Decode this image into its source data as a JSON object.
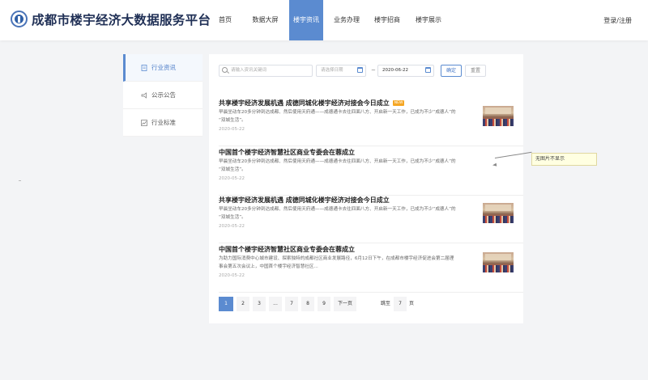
{
  "header": {
    "site_title": "成都市楼宇经济大数据服务平台",
    "nav": [
      {
        "label": "首页",
        "active": false
      },
      {
        "label": "数据大屏",
        "active": false
      },
      {
        "label": "楼宇资讯",
        "active": true
      },
      {
        "label": "业务办理",
        "active": false
      },
      {
        "label": "楼宇招商",
        "active": false
      },
      {
        "label": "楼宇展示",
        "active": false
      }
    ],
    "login_label": "登录/注册"
  },
  "sidebar": {
    "items": [
      {
        "label": "行业资讯",
        "icon": "document-icon",
        "active": true
      },
      {
        "label": "公示公告",
        "icon": "megaphone-icon",
        "active": false
      },
      {
        "label": "行业标准",
        "icon": "chart-icon",
        "active": false
      }
    ]
  },
  "search": {
    "keyword_placeholder": "请输入资讯关键词",
    "start_date_placeholder": "请选择日期",
    "date_separator": "~",
    "end_date_value": "2020-06-22",
    "confirm_label": "确定",
    "reset_label": "重置"
  },
  "news": [
    {
      "title": "共享楼宇经济发展机遇 成德同城化楼宇经济对接会今日成立",
      "badge": "NEW",
      "desc_line1": "早晨坐动车20多分钟到达成都、然后使用天府通——成德通卡去往四面八方、开启新一天工作，已成为不少“成德人”的",
      "desc_line2": "“双城生活”。",
      "date": "2020-05-22"
    },
    {
      "title": "中国首个楼宇经济智慧社区商业专委会在蓉成立",
      "badge": "",
      "desc_line1": "早晨坐动车20多分钟到达成都、然后使用天府通——成德通卡去往四面八方、开启新一天工作，已成为不少“成德人”的",
      "desc_line2": "“双城生活”。",
      "date": "2020-05-22"
    },
    {
      "title": "共享楼宇经济发展机遇 成德同城化楼宇经济对接会今日成立",
      "badge": "",
      "desc_line1": "早晨坐动车20多分钟到达成都、然后使用天府通——成德通卡去往四面八方、开启新一天工作，已成为不少“成德人”的",
      "desc_line2": "“双城生活”。",
      "date": "2020-05-22"
    },
    {
      "title": "中国首个楼宇经济智慧社区商业专委会在蓉成立",
      "badge": "",
      "desc_line1": "为助力国际消费中心城市建设、探索独特的成都社区商业发展路径，6月12日下午，在成都市楼宇经济促进会第二届理",
      "desc_line2": "事会第五次会议上，中国首个楼宇经济智慧社区...",
      "date": "2020-05-22"
    }
  ],
  "pagination": {
    "pages": [
      "1",
      "2",
      "3",
      "...",
      "7",
      "8",
      "9"
    ],
    "current": "1",
    "next_label": "下一页",
    "jump_prefix": "跳至",
    "jump_value": "7",
    "jump_suffix": "页"
  },
  "annotation": {
    "text": "无图片不显示"
  },
  "colors": {
    "accent": "#5b8bd0",
    "title": "#1f2f55",
    "badge": "#f5a623",
    "tooltip_bg": "#ffffe1"
  }
}
